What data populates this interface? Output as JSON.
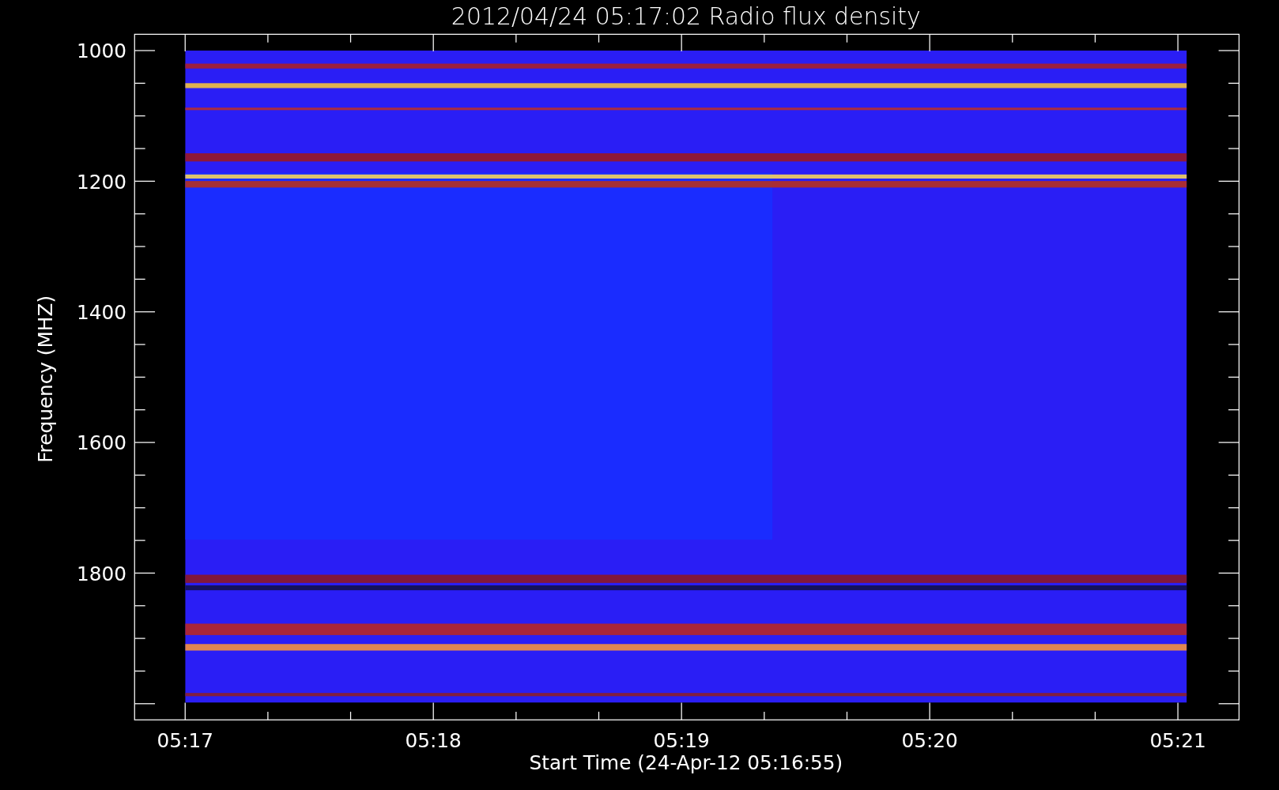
{
  "title": "2012/04/24 05:17:02 Radio flux density",
  "y_axis": {
    "label": "Frequency (MHZ)",
    "ticks": [
      "1000",
      "1200",
      "1400",
      "1600",
      "1800"
    ]
  },
  "x_axis": {
    "label": "Start Time (24-Apr-12 05:16:55)",
    "ticks": [
      "05:17",
      "05:18",
      "05:19",
      "05:20",
      "05:21"
    ]
  }
}
